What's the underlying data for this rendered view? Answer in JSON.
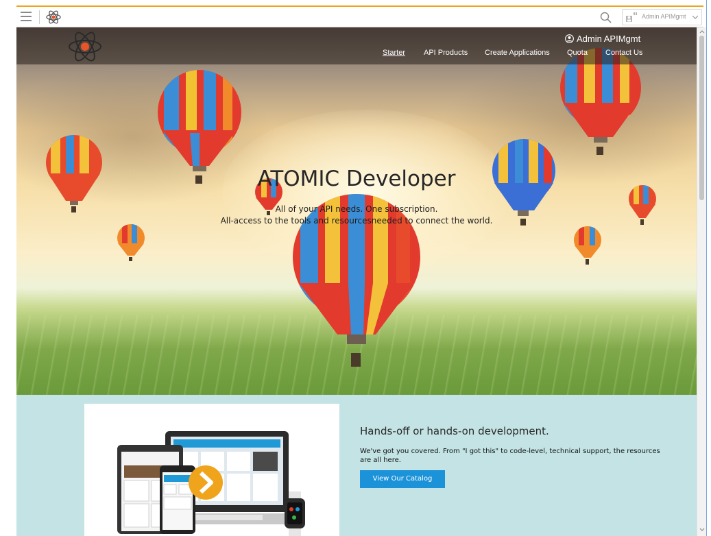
{
  "toolbar": {
    "user_label": "Admin APIMgmt",
    "accent_color": "#f0a41c",
    "icons": [
      "menu-icon",
      "atom-logo-icon",
      "search-icon",
      "user-avatar-icon",
      "chevron-down-icon"
    ]
  },
  "header": {
    "account_name": "Admin APIMgmt",
    "nav": [
      {
        "label": "Starter",
        "active": true
      },
      {
        "label": "API Products",
        "active": false
      },
      {
        "label": "Create Applications",
        "active": false
      },
      {
        "label": "Quota",
        "active": false
      },
      {
        "label": "Contact Us",
        "active": false
      }
    ]
  },
  "hero": {
    "title": "ATOMIC Developer",
    "subtitle_line1": "All of your API needs. One subscription.",
    "subtitle_line2": "All-access to the tools and resourcesneeded to connect the world."
  },
  "feature": {
    "title": "Hands-off or hands-on development.",
    "text": "We've got you covered. From \"I got this\" to code-level, technical support, the resources are all here.",
    "button_label": "View Our Catalog",
    "button_color": "#1c93d9",
    "background_color": "#c3e3e4"
  }
}
